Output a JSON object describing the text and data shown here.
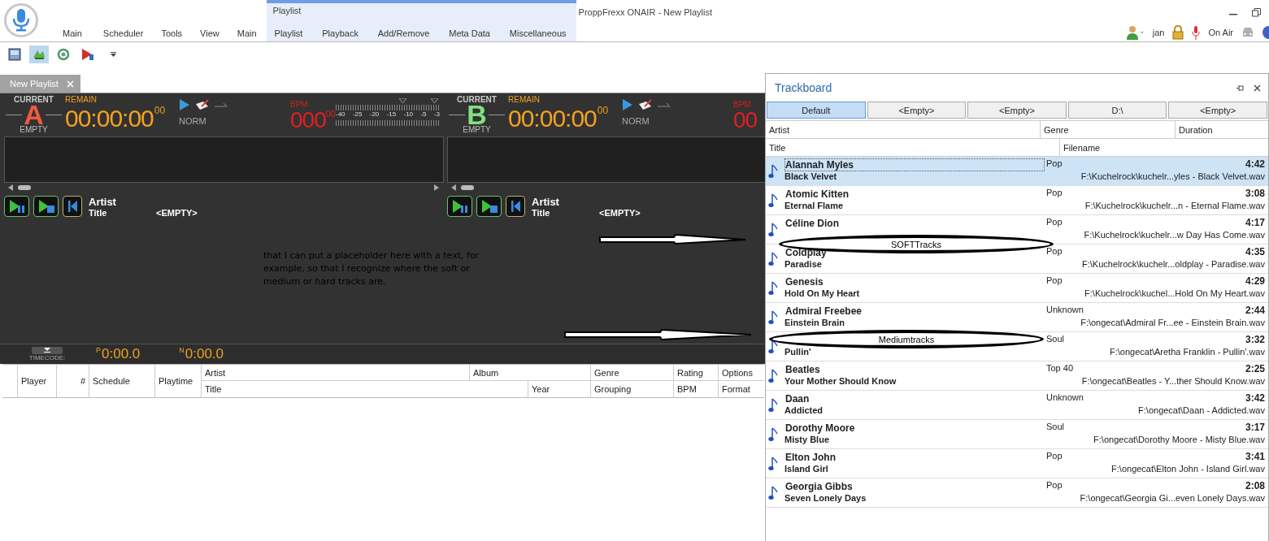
{
  "app": {
    "title": "ProppFrexx ONAIR - New Playlist",
    "context_group": "Playlist"
  },
  "menu": [
    {
      "label": "Main",
      "contextual": false
    },
    {
      "label": "Scheduler",
      "contextual": false
    },
    {
      "label": "Tools",
      "contextual": false
    },
    {
      "label": "View",
      "contextual": false
    },
    {
      "label": "Main",
      "contextual": false
    },
    {
      "label": "Playlist",
      "contextual": true
    },
    {
      "label": "Playback",
      "contextual": true
    },
    {
      "label": "Add/Remove",
      "contextual": true
    },
    {
      "label": "Meta Data",
      "contextual": true
    },
    {
      "label": "Miscellaneous",
      "contextual": true
    }
  ],
  "status": {
    "user": "jan",
    "on_air": "On Air"
  },
  "toolbar": [
    {
      "kind": "grid",
      "selected": false
    },
    {
      "kind": "landscape",
      "selected": true
    },
    {
      "kind": "disc",
      "selected": false
    },
    {
      "kind": "media",
      "selected": false
    }
  ],
  "doc_tabs": [
    {
      "label": "New Playlist",
      "selected": true
    }
  ],
  "decks": [
    {
      "current": "CURRENT",
      "letter": "A",
      "color": "#f05a40",
      "status": "EMPTY",
      "remain_label": "REMAIN",
      "time": "00:00:00",
      "frames": "00",
      "mode": "NORM",
      "bpm_label": "BPM",
      "bpm": "000",
      "bpm_frac": "00",
      "meter_ticks": [
        "-40",
        "-25",
        "-20",
        "-15",
        "-10",
        "-5",
        "-3"
      ],
      "artist_label": "Artist",
      "title_label": "Title",
      "title_value": "<EMPTY>"
    },
    {
      "current": "CURRENT",
      "letter": "B",
      "color": "#80e080",
      "status": "EMPTY",
      "remain_label": "REMAIN",
      "time": "00:00:00",
      "frames": "00",
      "mode": "NORM",
      "bpm_label": "BPM",
      "bpm": "00",
      "artist_label": "Artist",
      "title_label": "Title",
      "title_value": "<EMPTY>"
    }
  ],
  "note": "that I can put a placeholder here with a text, for example, so that I recognize where the soft or medium or hard tracks are.",
  "timecode": {
    "label": "TIMECODE:",
    "p_mark": "P",
    "p_time": "0:00.0",
    "n_mark": "N",
    "n_time": "0:00.0"
  },
  "playlist_table": {
    "columns": [
      "Player",
      "#",
      "Schedule",
      "Playtime"
    ],
    "columns_top": [
      "Artist",
      "Album",
      "Genre",
      "Rating",
      "Options"
    ],
    "columns_bottom": [
      "Title",
      "Year",
      "Grouping",
      "BPM",
      "Format"
    ]
  },
  "trackboard": {
    "title": "Trackboard",
    "buttons": [
      {
        "label": "Default",
        "selected": true
      },
      {
        "label": "<Empty>",
        "selected": false
      },
      {
        "label": "<Empty>",
        "selected": false
      },
      {
        "label": "D:\\",
        "selected": false
      },
      {
        "label": "<Empty>",
        "selected": false
      }
    ],
    "columns_top": [
      "Artist",
      "Genre",
      "Duration"
    ],
    "columns_bottom": [
      "Title",
      "Filename"
    ],
    "rows": [
      {
        "artist": "Alannah Myles",
        "title": "Black Velvet",
        "genre": "Pop",
        "duration": "4:42",
        "filename": "F:\\Kuchelrock\\kuchelr...yles - Black Velvet.wav",
        "selected": true
      },
      {
        "artist": "Atomic Kitten",
        "title": "Eternal Flame",
        "genre": "Pop",
        "duration": "3:08",
        "filename": "F:\\Kuchelrock\\kuchelr...n - Eternal Flame.wav",
        "selected": false
      },
      {
        "artist": "Céline Dion",
        "genre": "Pop",
        "duration": "4:17",
        "filename": "F:\\Kuchelrock\\kuchelr...w Day Has Come.wav",
        "selected": false
      },
      {
        "artist": "Coldplay",
        "title": "Paradise",
        "genre": "Pop",
        "duration": "4:35",
        "filename": "F:\\Kuchelrock\\kuchelr...oldplay - Paradise.wav",
        "selected": false
      },
      {
        "artist": "Genesis",
        "title": "Hold On My Heart",
        "genre": "Pop",
        "duration": "4:29",
        "filename": "F:\\Kuchelrock\\kuchel...Hold On My Heart.wav",
        "selected": false
      },
      {
        "artist": "Admiral Freebee",
        "title": "Einstein Brain",
        "genre": "Unknown",
        "duration": "2:44",
        "filename": "F:\\ongecat\\Admiral Fr...ee - Einstein Brain.wav",
        "selected": false
      },
      {
        "title": "Pullin'",
        "genre": "Soul",
        "duration": "3:32",
        "filename": "F:\\ongecat\\Aretha Franklin - Pullin'.wav",
        "selected": false
      },
      {
        "artist": "Beatles",
        "title": "Your Mother Should Know",
        "genre": "Top 40",
        "duration": "2:25",
        "filename": "F:\\ongecat\\Beatles - Y...ther Should Know.wav",
        "selected": false
      },
      {
        "artist": "Daan",
        "title": "Addicted",
        "genre": "Unknown",
        "duration": "3:42",
        "filename": "F:\\ongecat\\Daan - Addicted.wav",
        "selected": false
      },
      {
        "artist": "Dorothy Moore",
        "title": "Misty Blue",
        "genre": "Soul",
        "duration": "3:17",
        "filename": "F:\\ongecat\\Dorothy Moore - Misty Blue.wav",
        "selected": false
      },
      {
        "artist": "Elton John",
        "title": "Island Girl",
        "genre": "Pop",
        "duration": "3:41",
        "filename": "F:\\ongecat\\Elton John - Island Girl.wav",
        "selected": false
      },
      {
        "artist": "Georgia Gibbs",
        "title": "Seven Lonely Days",
        "genre": "Pop",
        "duration": "2:08",
        "filename": "F:\\ongecat\\Georgia Gi...even Lonely Days.wav",
        "selected": false
      }
    ],
    "callouts": [
      "SOFTTracks",
      "Mediumtracks"
    ]
  }
}
